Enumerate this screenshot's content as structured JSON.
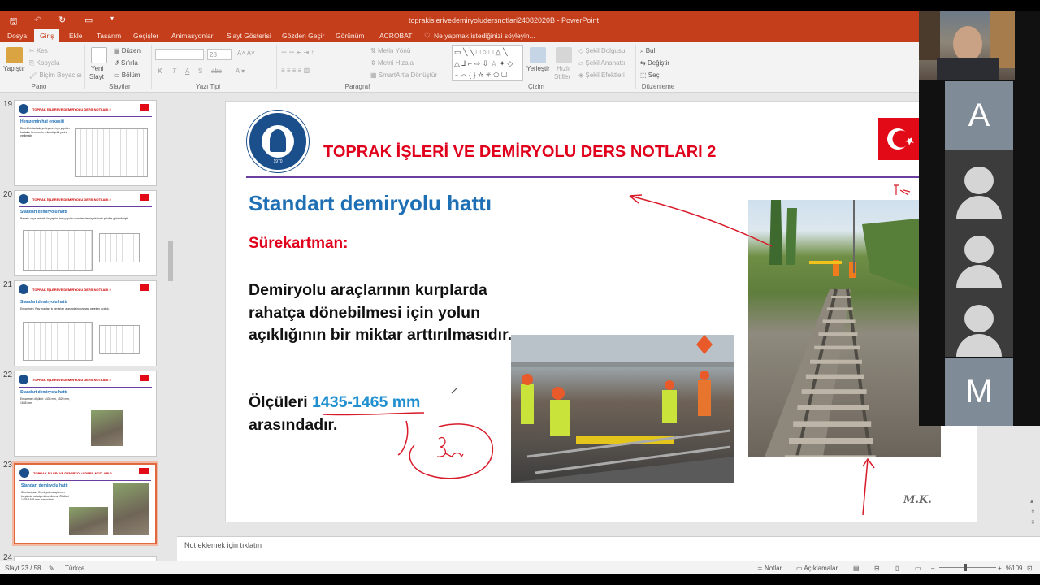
{
  "window": {
    "title": "toprakislerivedemiryoludersnotlari24082020B - PowerPoint",
    "qat_icons": [
      "save-icon",
      "undo-icon",
      "redo-icon",
      "slideshow-icon",
      "customize-icon"
    ]
  },
  "tabs": [
    "Dosya",
    "Giriş",
    "Ekle",
    "Tasarım",
    "Geçişler",
    "Animasyonlar",
    "Slayt Gösterisi",
    "Gözden Geçir",
    "Görünüm",
    "ACROBAT"
  ],
  "tell_me": "Ne yapmak istediğinizi söyleyin...",
  "ribbon": {
    "clipboard": {
      "paste": "Yapıştır",
      "cut": "Kes",
      "copy": "Kopyala",
      "format_painter": "Biçim Boyacısı",
      "label": "Pano"
    },
    "slides": {
      "new_slide_line1": "Yeni",
      "new_slide_line2": "Slayt",
      "layout": "Düzen",
      "reset": "Sıfırla",
      "section": "Bölüm",
      "label": "Slaytlar"
    },
    "font": {
      "font_size": "28",
      "label": "Yazı Tipi",
      "buttons": [
        "K",
        "T",
        "A",
        "S",
        "abc"
      ]
    },
    "paragraph": {
      "text_direction": "Metin Yönü",
      "align_text": "Metni Hizala",
      "smartart": "SmartArt'a Dönüştür",
      "label": "Paragraf"
    },
    "drawing": {
      "arrange": "Yerleştir",
      "quick_styles_line1": "Hızlı",
      "quick_styles_line2": "Stiller",
      "shape_fill": "Şekil Dolgusu",
      "shape_outline": "Şekil Anahattı",
      "shape_effects": "Şekil Efektleri",
      "label": "Çizim"
    },
    "editing": {
      "find": "Bul",
      "replace": "Değiştir",
      "select": "Seç",
      "label": "Düzenleme"
    }
  },
  "thumbnails": [
    {
      "num": "19",
      "header": "TOPRAK İŞLERİ VE DEMİRYOLU DERS NOTLARI 2",
      "title": "Hemzemin hat enkesiti",
      "text": "Dimeli bir tarlada yerleşecek için yapılan kurbalar hemzemin enkesit şekli yerine verilmiştir."
    },
    {
      "num": "20",
      "header": "TOPRAK İŞLERİ VE DEMİRYOLU DERS NOTLARI 2",
      "title": "Standart demiryolu hattı",
      "text": "Balastlı veya betonlu üstyapılar tam yapılan standart demiryolu hattı şekilde gösterilmiştir."
    },
    {
      "num": "21",
      "header": "TOPRAK İŞLERİ VE DEMİRYOLU DERS NOTLARI 2",
      "title": "Standart demiryolu hattı",
      "text": "Enkartman: Ray mantarı iç kenarları arasında bulunması gereken açıklık."
    },
    {
      "num": "22",
      "header": "TOPRAK İŞLERİ VE DEMİRYOLU DERS NOTLARI 2",
      "title": "Standart demiryolu hattı",
      "text": "Enkartman ölçüleri: 1435 mm, 1520 mm, 1668 mm"
    },
    {
      "num": "23",
      "header": "TOPRAK İŞLERİ VE DEMİRYOLU DERS NOTLARI 2",
      "title": "Standart demiryolu hattı",
      "text": "Sürekartman: Demiryolu araçlarının kurplarda rahatça dönebilmesi. Ölçüleri 1435-1465 mm arasındadır."
    },
    {
      "num": "24",
      "header": "",
      "title": "",
      "text": ""
    }
  ],
  "slide": {
    "header": "TOPRAK İŞLERİ VE DEMİRYOLU DERS NOTLARI 2",
    "logo_year": "1970",
    "title": "Standart demiryolu hattı",
    "subtitle": "Sürekartman:",
    "body": "Demiryolu araçlarının kurplarda rahatça dönebilmesi için yolun açıklığının bir miktar arttırılmasıdır.",
    "measure_prefix": "Ölçüleri ",
    "measure_value": "1435-1465 mm",
    "measure_suffix": "arasındadır.",
    "signature": "M.K."
  },
  "notes_placeholder": "Not eklemek için tıklatın",
  "status": {
    "slide_info": "Slayt 23 / 58",
    "language": "Türkçe",
    "notes": "Notlar",
    "comments": "Açıklamalar",
    "zoom": "%109"
  },
  "participants": [
    "A",
    "",
    "",
    "",
    "M"
  ],
  "colors": {
    "accent": "#c43e1c",
    "slide_red": "#e0001b",
    "slide_blue": "#1f6fb5",
    "ink": "#d81b2a"
  }
}
